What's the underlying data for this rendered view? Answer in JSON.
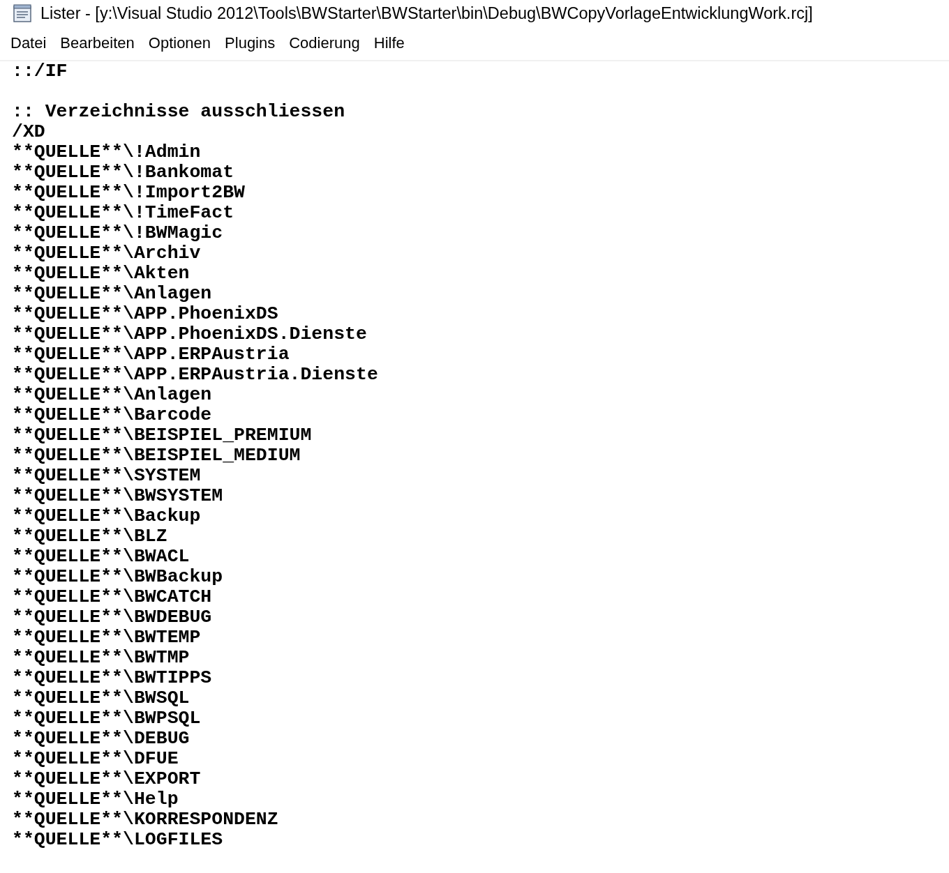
{
  "window": {
    "title": "Lister - [y:\\Visual Studio 2012\\Tools\\BWStarter\\BWStarter\\bin\\Debug\\BWCopyVorlageEntwicklungWork.rcj]"
  },
  "menu": [
    "Datei",
    "Bearbeiten",
    "Optionen",
    "Plugins",
    "Codierung",
    "Hilfe"
  ],
  "lines": [
    {
      "kind": "text",
      "text": "::/IF"
    },
    {
      "kind": "blank"
    },
    {
      "kind": "text",
      "text": ":: Verzeichnisse ausschliessen"
    },
    {
      "kind": "text",
      "text": "/XD"
    },
    {
      "kind": "text",
      "text": "**QUELLE**\\!Admin"
    },
    {
      "kind": "text",
      "text": "**QUELLE**\\!Bankomat"
    },
    {
      "kind": "text",
      "text": "**QUELLE**\\!Import2BW"
    },
    {
      "kind": "text",
      "text": "**QUELLE**\\!TimeFact"
    },
    {
      "kind": "text",
      "text": "**QUELLE**\\!BWMagic"
    },
    {
      "kind": "text",
      "text": "**QUELLE**\\Archiv"
    },
    {
      "kind": "text",
      "text": "**QUELLE**\\Akten"
    },
    {
      "kind": "text",
      "text": "**QUELLE**\\Anlagen"
    },
    {
      "kind": "text",
      "text": "**QUELLE**\\APP.PhoenixDS"
    },
    {
      "kind": "text",
      "text": "**QUELLE**\\APP.PhoenixDS.Dienste"
    },
    {
      "kind": "text",
      "text": "**QUELLE**\\APP.ERPAustria"
    },
    {
      "kind": "text",
      "text": "**QUELLE**\\APP.ERPAustria.Dienste"
    },
    {
      "kind": "text",
      "text": "**QUELLE**\\Anlagen"
    },
    {
      "kind": "text",
      "text": "**QUELLE**\\Barcode"
    },
    {
      "kind": "text",
      "text": "**QUELLE**\\BEISPIEL_PREMIUM"
    },
    {
      "kind": "text",
      "text": "**QUELLE**\\BEISPIEL_MEDIUM"
    },
    {
      "kind": "text",
      "text": "**QUELLE**\\SYSTEM"
    },
    {
      "kind": "text",
      "text": "**QUELLE**\\BWSYSTEM"
    },
    {
      "kind": "text",
      "text": "**QUELLE**\\Backup"
    },
    {
      "kind": "text",
      "text": "**QUELLE**\\BLZ"
    },
    {
      "kind": "text",
      "text": "**QUELLE**\\BWACL"
    },
    {
      "kind": "text",
      "text": "**QUELLE**\\BWBackup"
    },
    {
      "kind": "text",
      "text": "**QUELLE**\\BWCATCH"
    },
    {
      "kind": "text",
      "text": "**QUELLE**\\BWDEBUG"
    },
    {
      "kind": "text",
      "text": "**QUELLE**\\BWTEMP"
    },
    {
      "kind": "text",
      "text": "**QUELLE**\\BWTMP"
    },
    {
      "kind": "text",
      "text": "**QUELLE**\\BWTIPPS"
    },
    {
      "kind": "text",
      "text": "**QUELLE**\\BWSQL"
    },
    {
      "kind": "text",
      "text": "**QUELLE**\\BWPSQL"
    },
    {
      "kind": "text",
      "text": "**QUELLE**\\DEBUG"
    },
    {
      "kind": "text",
      "text": "**QUELLE**\\DFUE"
    },
    {
      "kind": "text",
      "text": "**QUELLE**\\EXPORT"
    },
    {
      "kind": "text",
      "text": "**QUELLE**\\Help"
    },
    {
      "kind": "text",
      "text": "**QUELLE**\\KORRESPONDENZ"
    },
    {
      "kind": "text",
      "text": "**QUELLE**\\LOGFILES"
    }
  ]
}
